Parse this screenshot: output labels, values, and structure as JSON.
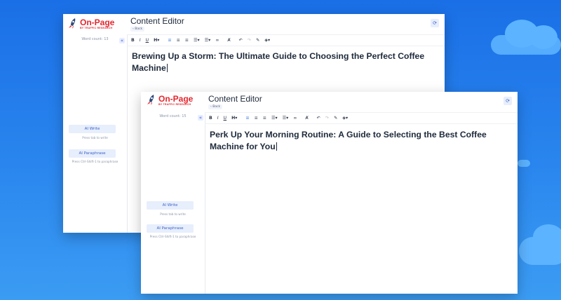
{
  "window_back": {
    "logo": {
      "brand": "On-Page",
      "sub": "BY TRAFFIC RESEARCH"
    },
    "word_count": "Word count: 13",
    "collapse_label": "«",
    "ai_write": {
      "label": "AI Write",
      "hint": "Press tab to write"
    },
    "ai_paraphrase": {
      "label": "AI Paraphrase",
      "hint": "Press Ctrl-Shift-1 to paraphrase"
    },
    "title": "Content Editor",
    "back_label": "‹  Back",
    "heading": "Brewing Up a Storm: The Ultimate Guide to Choosing the Perfect Coffee Machine"
  },
  "window_front": {
    "logo": {
      "brand": "On-Page",
      "sub": "BY TRAFFIC RESEARCH"
    },
    "word_count": "Word count: 15",
    "collapse_label": "«",
    "ai_write": {
      "label": "AI Write",
      "hint": "Press tab to write"
    },
    "ai_paraphrase": {
      "label": "AI Paraphrase",
      "hint": "Press Ctrl-Shift-1 to paraphrase"
    },
    "title": "Content Editor",
    "back_label": "‹  Back",
    "heading": "Perk Up Your Morning Routine: A Guide to Selecting the Best Coffee Machine for You"
  },
  "toolbar": {
    "bold": "B",
    "italic": "I",
    "underline": "U",
    "heading": "H▾",
    "align_left": "≡",
    "align_center": "≡",
    "align_right": "≡",
    "ordered_list": "☰▾",
    "bullet_list": "☰▾",
    "link": "∞",
    "clear_format": "Ⱥ",
    "undo": "↶",
    "redo": "↷",
    "pen": "✎",
    "color": "◈▾"
  },
  "colors": {
    "brand": "#e3262d",
    "accent": "#2f6fe0",
    "background": "#1a6fe6"
  }
}
